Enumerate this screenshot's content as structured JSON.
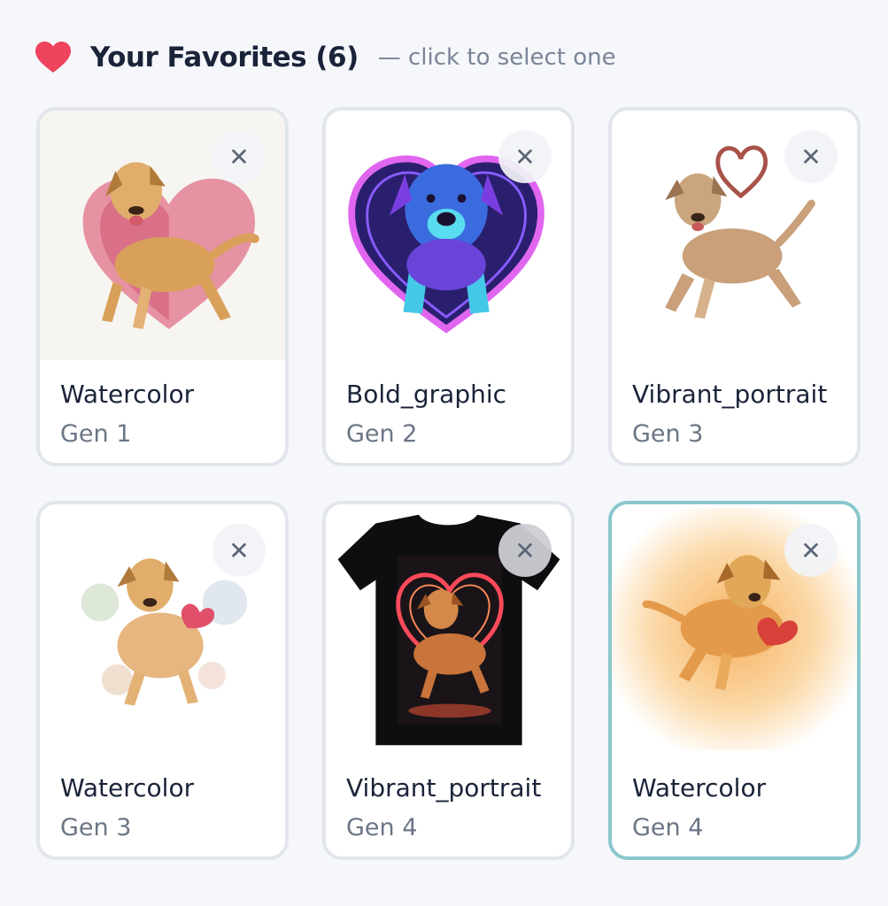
{
  "header": {
    "title": "Your Favorites (6)",
    "subtitle": "— click to select one",
    "heart_color": "#f0435e"
  },
  "cards": [
    {
      "title": "Watercolor",
      "gen": "Gen 1",
      "selected": false
    },
    {
      "title": "Bold_graphic",
      "gen": "Gen 2",
      "selected": false
    },
    {
      "title": "Vibrant_portrait",
      "gen": "Gen 3",
      "selected": false
    },
    {
      "title": "Watercolor",
      "gen": "Gen 3",
      "selected": false
    },
    {
      "title": "Vibrant_portrait",
      "gen": "Gen 4",
      "selected": false
    },
    {
      "title": "Watercolor",
      "gen": "Gen 4",
      "selected": true
    }
  ],
  "remove_label": "✕",
  "colors": {
    "selected_border": "#8ac7cc",
    "card_border": "#e2e5ec",
    "background": "#f5f7fb"
  }
}
